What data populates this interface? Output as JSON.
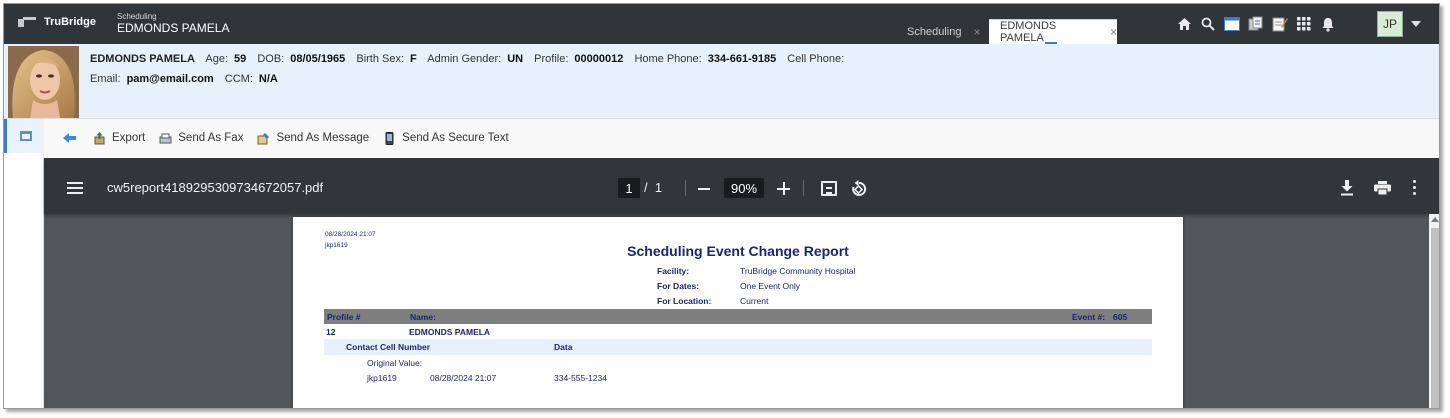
{
  "topbar": {
    "brand": "TruBridge",
    "context_module": "Scheduling",
    "context_patient": "EDMONDS PAMELA",
    "tabs": [
      {
        "label": "Scheduling",
        "active": false
      },
      {
        "label": "EDMONDS PAMELA",
        "active": true
      }
    ],
    "icons": [
      "home-icon",
      "search-icon",
      "window-icon",
      "documents-icon",
      "notes-icon",
      "apps-grid-icon",
      "bell-icon"
    ],
    "user_initials": "JP"
  },
  "patient": {
    "name": "EDMONDS PAMELA",
    "fields_line1": [
      {
        "label": "Age:",
        "value": "59"
      },
      {
        "label": "DOB:",
        "value": "08/05/1965"
      },
      {
        "label": "Birth Sex:",
        "value": "F"
      },
      {
        "label": "Admin Gender:",
        "value": "UN"
      },
      {
        "label": "Profile:",
        "value": "00000012"
      },
      {
        "label": "Home Phone:",
        "value": "334-661-9185"
      },
      {
        "label": "Cell Phone:",
        "value": ""
      }
    ],
    "fields_line2": [
      {
        "label": "Email:",
        "value": "pam@email.com"
      },
      {
        "label": "CCM:",
        "value": "N/A"
      }
    ]
  },
  "actions": {
    "export": "Export",
    "send_fax": "Send As Fax",
    "send_message": "Send As Message",
    "send_secure_text": "Send As Secure Text"
  },
  "viewer": {
    "filename": "cw5report4189295309734672057.pdf",
    "current_page": "1",
    "page_separator": "/",
    "total_pages": "1",
    "zoom": "90%"
  },
  "report": {
    "printed_at": "08/28/2024 21:07",
    "printed_by": "jkp1619",
    "title": "Scheduling Event Change Report",
    "meta": [
      {
        "label": "Facility:",
        "value": "TruBridge Community Hospital"
      },
      {
        "label": "For Dates:",
        "value": "One Event Only"
      },
      {
        "label": "For Location:",
        "value": "Current"
      }
    ],
    "header": {
      "profile_label": "Profile #",
      "name_label": "Name:",
      "event_label": "Event #:",
      "event_value": "605"
    },
    "profile_number": "12",
    "patient_name": "EDMONDS PAMELA",
    "change_field": "Contact Cell Number",
    "change_type": "Data",
    "original_label": "Original Value:",
    "change_user": "jkp1619",
    "change_time": "08/28/2024 21:07",
    "change_value": "334-555-1234"
  },
  "colors": {
    "topbar": "#2f3538",
    "banner": "#e7f1fb",
    "viewer_bg": "#525659",
    "viewer_toolbar": "#323639",
    "report_text": "#1a237e",
    "accent": "#3b7bd3"
  }
}
